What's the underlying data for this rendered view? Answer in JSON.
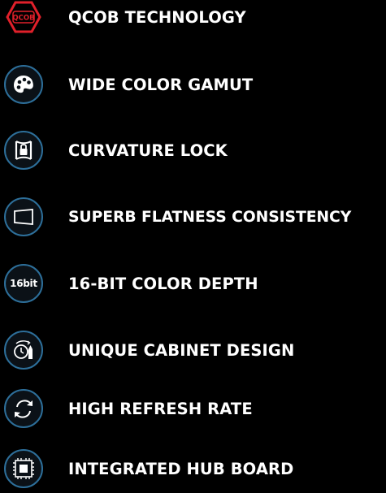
{
  "features": [
    {
      "label": "QCOB TECHNOLOGY",
      "icon": "qcob-hexagon-icon",
      "icon_text": "QCOB",
      "accent": "#e0202a"
    },
    {
      "label": "WIDE COLOR GAMUT",
      "icon": "color-palette-icon"
    },
    {
      "label": "CURVATURE LOCK",
      "icon": "curvature-lock-icon"
    },
    {
      "label": "SUPERB FLATNESS CONSISTENCY",
      "icon": "flat-panel-icon"
    },
    {
      "label": "16-BIT COLOR DEPTH",
      "icon": "color-depth-icon",
      "icon_text": "16bit"
    },
    {
      "label": "UNIQUE CABINET DESIGN",
      "icon": "cabinet-design-icon"
    },
    {
      "label": "HIGH REFRESH RATE",
      "icon": "refresh-icon"
    },
    {
      "label": "INTEGRATED HUB BOARD",
      "icon": "hub-board-icon"
    }
  ],
  "colors": {
    "ring": "#2d6f9a",
    "icon_fill": "#0b1117",
    "text": "#ffffff",
    "background": "#000000"
  }
}
